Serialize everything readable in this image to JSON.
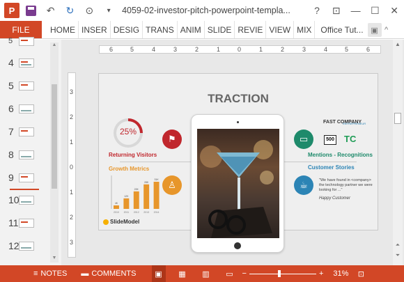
{
  "titlebar": {
    "app_icon": "P",
    "undo_icon": "undo-icon",
    "title": "4059-02-investor-pitch-powerpoint-templa...",
    "help": "?",
    "restore": "⊡",
    "minimize": "—",
    "maximize": "☐",
    "close": "✕"
  },
  "ribbon": {
    "file": "FILE",
    "tabs": [
      "HOME",
      "INSER",
      "DESIG",
      "TRANS",
      "ANIM",
      "SLIDE",
      "REVIE",
      "VIEW",
      "MIX"
    ],
    "account": "Office Tut...",
    "collapse": "^"
  },
  "thumbnails": {
    "numbers": [
      "5",
      "4",
      "5",
      "6",
      "7",
      "8",
      "9",
      "10",
      "11",
      "12"
    ]
  },
  "ruler": {
    "horizontal": [
      "6",
      "5",
      "4",
      "3",
      "2",
      "1",
      "0",
      "1",
      "2",
      "3",
      "4",
      "5",
      "6"
    ],
    "vertical": [
      "3",
      "2",
      "1",
      "0",
      "1",
      "2",
      "3"
    ]
  },
  "slide": {
    "title": "TRACTION",
    "donut_value": "25%",
    "donut_fraction": 0.25,
    "returning_visitors": "Returning Visitors",
    "growth_metrics": "Growth Metrics",
    "mentions": "Mentions - Recognitions",
    "customer_stories": "Customer Stories",
    "quote": "\"We have found in <company> the technology partner we were looking for ...\"",
    "quote_author": "Happy Customer",
    "logo": "SlideModel",
    "press_top": "FAST COMPANY",
    "press_small": "ENTREPRENEUR",
    "press_box": "500",
    "press_tc": "TC"
  },
  "chart_data": {
    "type": "bar",
    "categories": [
      "2010",
      "2011",
      "2012",
      "2013",
      "2014"
    ],
    "values": [
      4,
      12,
      20,
      28,
      31
    ],
    "data_labels": [
      "4K",
      "12K",
      "20K",
      "28K",
      "31K"
    ],
    "ylim": [
      0,
      35
    ],
    "color": "#e7962b"
  },
  "statusbar": {
    "notes": "NOTES",
    "comments": "COMMENTS",
    "zoom_minus": "−",
    "zoom_plus": "+",
    "zoom": "31%",
    "zoom_fraction": 0.45
  },
  "colors": {
    "accent": "#d24726",
    "red": "#c0272d",
    "orange": "#e7962b",
    "green": "#1e8a6b",
    "blue": "#2c84b5"
  }
}
